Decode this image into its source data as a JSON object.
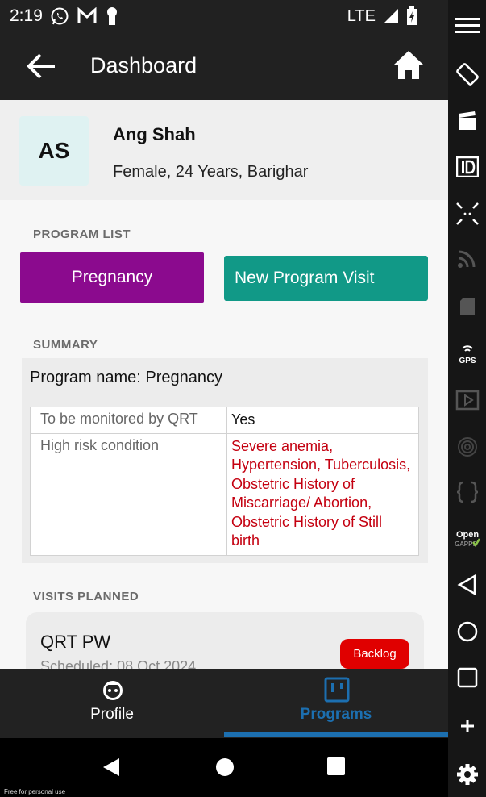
{
  "status_bar": {
    "time": "2:19",
    "network": "LTE"
  },
  "app_bar": {
    "title": "Dashboard"
  },
  "profile": {
    "initials": "AS",
    "name": "Ang Shah",
    "details": "Female, 24 Years, Barighar"
  },
  "program_list": {
    "label": "PROGRAM LIST",
    "program_button": "Pregnancy",
    "new_visit_button": "New Program Visit"
  },
  "summary": {
    "label": "SUMMARY",
    "program_name": "Program name: Pregnancy",
    "rows": [
      {
        "label": "To be monitored by QRT",
        "value": "Yes"
      },
      {
        "label": "High risk condition",
        "value": "Severe anemia, Hypertension, Tuberculosis, Obstetric History of Miscarriage/ Abortion, Obstetric History of Still birth"
      }
    ]
  },
  "visits_planned": {
    "label": "VISITS PLANNED",
    "visit_name": "QRT PW",
    "scheduled": "Scheduled: 08 Oct 2024",
    "status": "Backlog"
  },
  "bottom_nav": {
    "profile": "Profile",
    "programs": "Programs"
  },
  "footer_note": "Free for personal use",
  "colors": {
    "program_button": "#8b0a8e",
    "new_visit_button": "#119987",
    "high_risk": "#c40010",
    "backlog": "#e00000",
    "active_tab": "#1c6fb0"
  }
}
